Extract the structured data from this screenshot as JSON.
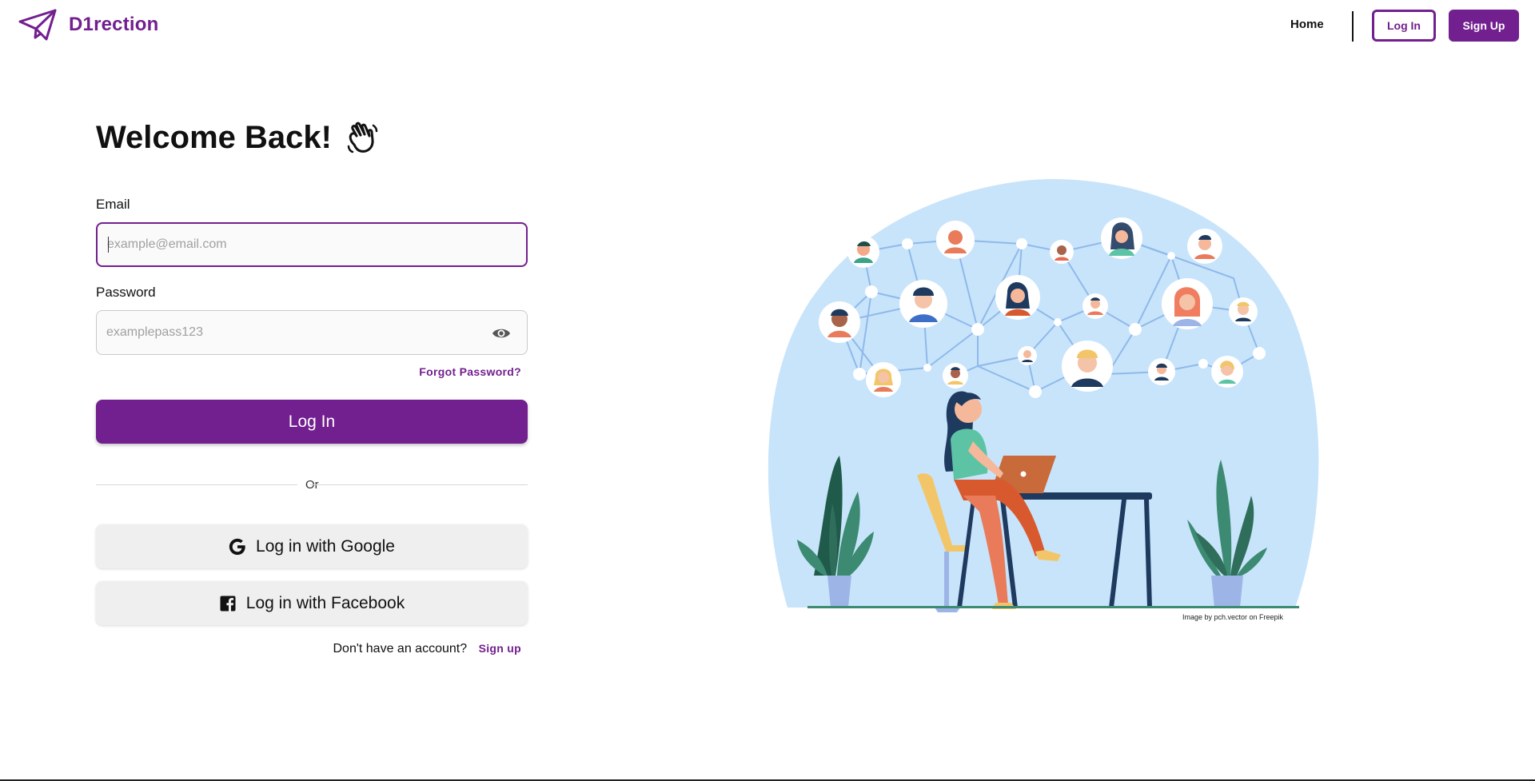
{
  "nav": {
    "brand": "D1rection",
    "home": "Home",
    "login": "Log In",
    "signup": "Sign Up"
  },
  "form": {
    "title": "Welcome Back!",
    "email_label": "Email",
    "email_placeholder": "example@email.com",
    "password_label": "Password",
    "password_placeholder": "examplepass123",
    "forgot": "Forgot Password?",
    "submit": "Log In",
    "or": "Or",
    "google": "Log in with Google",
    "facebook": "Log in with Facebook",
    "no_account": "Don't have an account?",
    "signup_link": "Sign up"
  },
  "illustration": {
    "credit": "Image by pch.vector on Freepik"
  },
  "colors": {
    "brand": "#721f8f",
    "background": "#ffffff",
    "input_bg": "#fafafa",
    "social_bg": "#efefef",
    "illustration_bg": "#c8e4fb"
  },
  "icons": {
    "brand": "paper-plane-icon",
    "welcome": "waving-hand-icon",
    "password_toggle": "eye-icon",
    "google": "google-icon",
    "facebook": "facebook-icon"
  }
}
